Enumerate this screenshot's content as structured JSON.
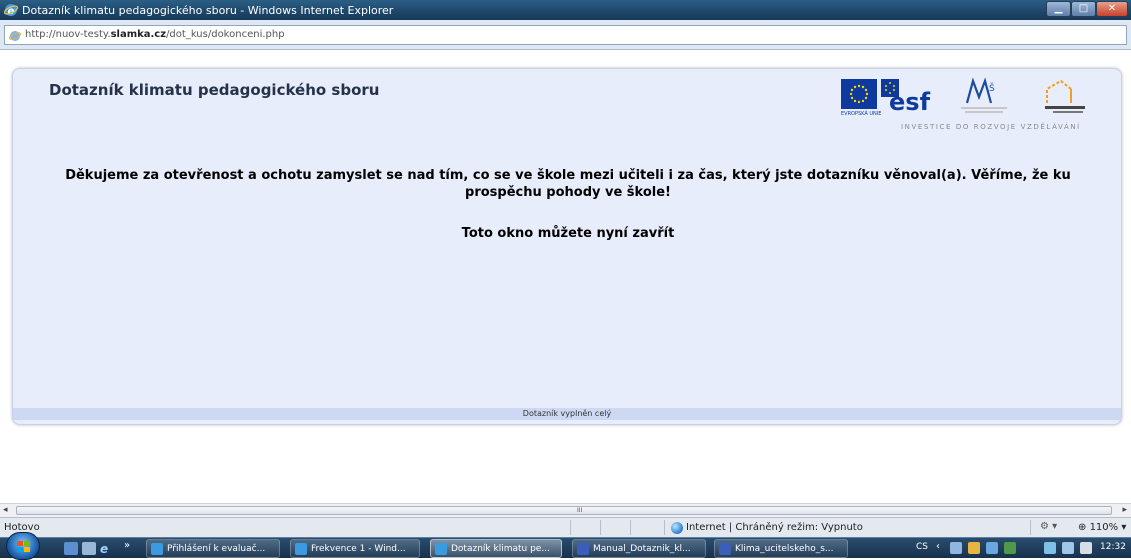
{
  "window": {
    "title": "Dotazník klimatu pedagogického sboru - Windows Internet Explorer",
    "minimize_icon": "minimize-icon",
    "maximize_icon": "maximize-icon",
    "close_icon": "close-icon"
  },
  "address": {
    "url_prefix": "http://nuov-testy.",
    "url_domain": "slamka.cz",
    "url_path": "/dot_kus/dokonceni.php"
  },
  "page": {
    "title": "Dotazník klimatu pedagogického sboru",
    "logo_eu_caption": "EVROPSKÁ UNIE",
    "logo_esf_text": "esf",
    "logo_msmt_text": "MŠMT",
    "invest_line": "INVESTICE DO ROZVOJE VZDĚLÁVÁNÍ",
    "message_line1": "Děkujeme za otevřenost a ochotu zamyslet se nad tím, co se ve škole mezi učiteli i za čas, který jste dotazníku věnoval(a). Věříme, že ku prospěchu pohody ve škole!",
    "message_line2": "Toto okno můžete nyní zavřít",
    "footer": "Dotazník vyplněn celý"
  },
  "scrollbar": {
    "grip": "III"
  },
  "status": {
    "left": "Hotovo",
    "zone": "Internet | Chráněný režim: Vypnuto",
    "zoom": "110%"
  },
  "taskbar": {
    "more": "»",
    "tasks": [
      {
        "label": "Přihlášení k evaluač...",
        "icon": "ie-icon"
      },
      {
        "label": "Frekvence 1 - Wind...",
        "icon": "ie-icon"
      },
      {
        "label": "Dotazník klimatu pe...",
        "icon": "ie-icon"
      },
      {
        "label": "Manual_Dotaznik_kl...",
        "icon": "word-icon"
      },
      {
        "label": "Klima_ucitelskeho_s...",
        "icon": "word-icon"
      }
    ],
    "lang": "CS",
    "clock": "12:32"
  },
  "colors": {
    "panel_bg": "#e8edfb",
    "footer_bg": "#cdd8f2",
    "title_color": "#26324a"
  }
}
